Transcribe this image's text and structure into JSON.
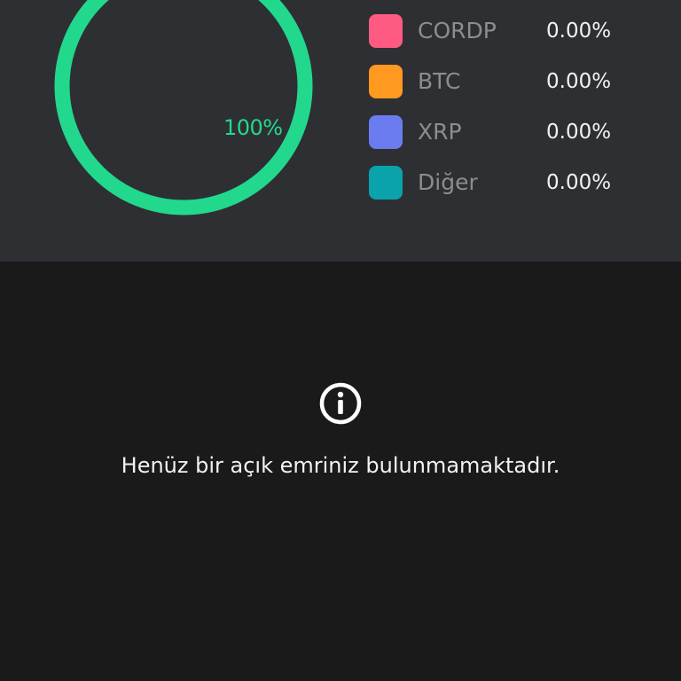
{
  "donut": {
    "percent_label": "100%",
    "fill_fraction": 1.0,
    "color": "#22d88d"
  },
  "legend": [
    {
      "name": "CORDP",
      "value": "0.00%",
      "color": "#ff5a82"
    },
    {
      "name": "BTC",
      "value": "0.00%",
      "color": "#ff9920"
    },
    {
      "name": "XRP",
      "value": "0.00%",
      "color": "#6a7cf0"
    },
    {
      "name": "Diğer",
      "value": "0.00%",
      "color": "#0aa3ab"
    }
  ],
  "orders": {
    "icon": "info-icon",
    "empty_message": "Henüz bir açık emriniz bulunmamaktadır."
  }
}
